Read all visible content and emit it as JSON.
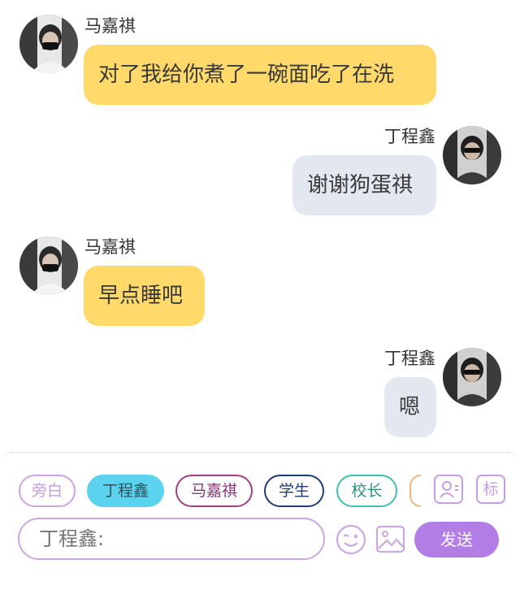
{
  "messages": [
    {
      "speaker": "马嘉祺",
      "text": "对了我给你煮了一碗面吃了在洗",
      "side": "left"
    },
    {
      "speaker": "丁程鑫",
      "text": "谢谢狗蛋祺",
      "side": "right"
    },
    {
      "speaker": "马嘉祺",
      "text": "早点睡吧",
      "side": "left"
    },
    {
      "speaker": "丁程鑫",
      "text": "嗯",
      "side": "right"
    }
  ],
  "role_chips": [
    {
      "label": "旁白",
      "color": "#cfa3e6",
      "selected": false
    },
    {
      "label": "丁程鑫",
      "color": "#5cd3ee",
      "selected": true
    },
    {
      "label": "马嘉祺",
      "color": "#a03f86",
      "selected": false
    },
    {
      "label": "学生",
      "color": "#1f3b7a",
      "selected": false
    },
    {
      "label": "校长",
      "color": "#3fbfb0",
      "selected": false
    }
  ],
  "toolbar": {
    "character_icon": "person-card-icon",
    "tag_label": "标",
    "emoji_icon": "wink-face-icon",
    "image_icon": "image-icon"
  },
  "composer": {
    "placeholder": "丁程鑫:",
    "send_label": "发送"
  },
  "colors": {
    "left_bubble": "#ffd96a",
    "right_bubble": "#e3e8f0",
    "accent": "#b27ee6"
  }
}
